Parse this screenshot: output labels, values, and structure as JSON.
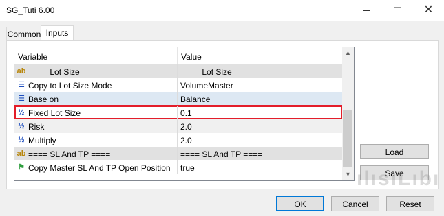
{
  "window": {
    "title": "SG_Tuti 6.00"
  },
  "tabs": [
    {
      "label": "Common",
      "active": false
    },
    {
      "label": "Inputs",
      "active": true
    }
  ],
  "grid": {
    "columns": [
      "Variable",
      "Value"
    ],
    "rows": [
      {
        "icon": "ab-string-icon",
        "variable": "==== Lot Size ====",
        "value": "==== Lot Size ===="
      },
      {
        "icon": "enum-list-icon",
        "variable": "Copy to Lot Size Mode",
        "value": "VolumeMaster"
      },
      {
        "icon": "enum-list-icon",
        "variable": "Base on",
        "value": "Balance"
      },
      {
        "icon": "fraction-double-icon",
        "variable": "Fixed Lot Size",
        "value": "0.1"
      },
      {
        "icon": "fraction-double-icon",
        "variable": "Risk",
        "value": "2.0"
      },
      {
        "icon": "fraction-double-icon",
        "variable": "Multiply",
        "value": "2.0"
      },
      {
        "icon": "ab-string-icon",
        "variable": "==== SL And TP ====",
        "value": "==== SL And TP ===="
      },
      {
        "icon": "bool-flag-icon",
        "variable": "Copy Master SL And TP Open Position",
        "value": "true"
      }
    ],
    "highlight_color": "#e31d2a"
  },
  "buttons": {
    "load": "Load",
    "save": "Save",
    "ok": "OK",
    "cancel": "Cancel",
    "reset": "Reset"
  },
  "watermark": "ılısıLıbı"
}
